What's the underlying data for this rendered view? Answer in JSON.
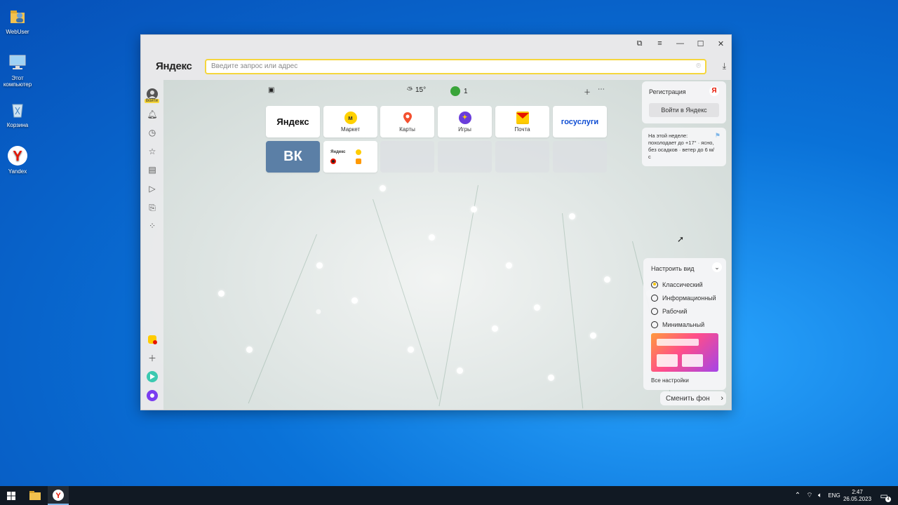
{
  "desktop": {
    "icons": [
      {
        "label": "WebUser",
        "icon": "user-folder-icon"
      },
      {
        "label": "Этот компьютер",
        "icon": "computer-icon"
      },
      {
        "label": "Корзина",
        "icon": "recycle-bin-icon"
      },
      {
        "label": "Yandex",
        "icon": "yandex-browser-icon"
      }
    ]
  },
  "browser": {
    "brand": "Яндекс",
    "omnibox_placeholder": "Введите запрос или адрес",
    "sidebar": {
      "login_badge": "Войти"
    },
    "strip": {
      "weather_temp": "15°",
      "counter": "1"
    },
    "tiles": [
      {
        "label": "",
        "brand": "Яндекс"
      },
      {
        "label": "Маркет"
      },
      {
        "label": "Карты"
      },
      {
        "label": "Игры"
      },
      {
        "label": "Почта"
      },
      {
        "label": "",
        "brand": "госуслуги"
      },
      {
        "label": "",
        "brand": "ВК"
      },
      {
        "label": "",
        "brand": "Яндекс"
      }
    ],
    "account_panel": {
      "title": "Регистрация",
      "login_button": "Войти в Яндекс"
    },
    "weather_panel": {
      "text": "На этой неделе: похолодает до +17° · ясно, без осадков · ветер до 6 м/с"
    },
    "view_panel": {
      "title": "Настроить вид",
      "options": [
        "Классический",
        "Информационный",
        "Рабочий",
        "Минимальный"
      ],
      "selected": "Классический",
      "all_settings": "Все настройки"
    },
    "change_bg_button": "Сменить фон"
  },
  "taskbar": {
    "language": "ENG",
    "time": "2:47",
    "date": "26.05.2023",
    "notifications": "4"
  },
  "colors": {
    "accent": "#f5d63d",
    "vk": "#5b7fa6",
    "taskbar": "#111923"
  }
}
